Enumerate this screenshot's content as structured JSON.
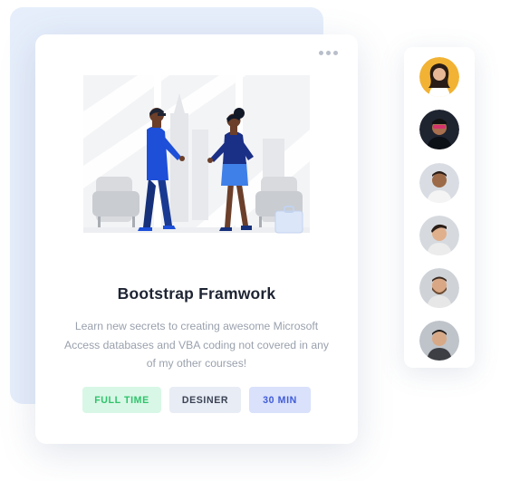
{
  "card": {
    "title": "Bootstrap Framwork",
    "description": "Learn new secrets to creating awesome Microsoft Access databases and VBA coding not covered in any of my other courses!",
    "tags": [
      {
        "label": "FULL TIME",
        "bg": "#d9f7e6",
        "color": "#2ec36b"
      },
      {
        "label": "DESINER",
        "bg": "#e8ecf4",
        "color": "#3b4254"
      },
      {
        "label": "30 MIN",
        "bg": "#d9e1fb",
        "color": "#3f5bd8"
      }
    ],
    "menu_icon": "more-horizontal-icon",
    "illustration": "two-people-meeting-office-illustration"
  },
  "avatars": [
    {
      "name": "avatar-1",
      "bg": "#f2b233"
    },
    {
      "name": "avatar-2",
      "bg": "#1e2430"
    },
    {
      "name": "avatar-3",
      "bg": "#d9dde3"
    },
    {
      "name": "avatar-4",
      "bg": "#d6dadf"
    },
    {
      "name": "avatar-5",
      "bg": "#cfd3d8"
    },
    {
      "name": "avatar-6",
      "bg": "#bfc4ca"
    }
  ],
  "colors": {
    "accent_blue": "#1d4fd8",
    "back_card": "#e6eefb"
  }
}
